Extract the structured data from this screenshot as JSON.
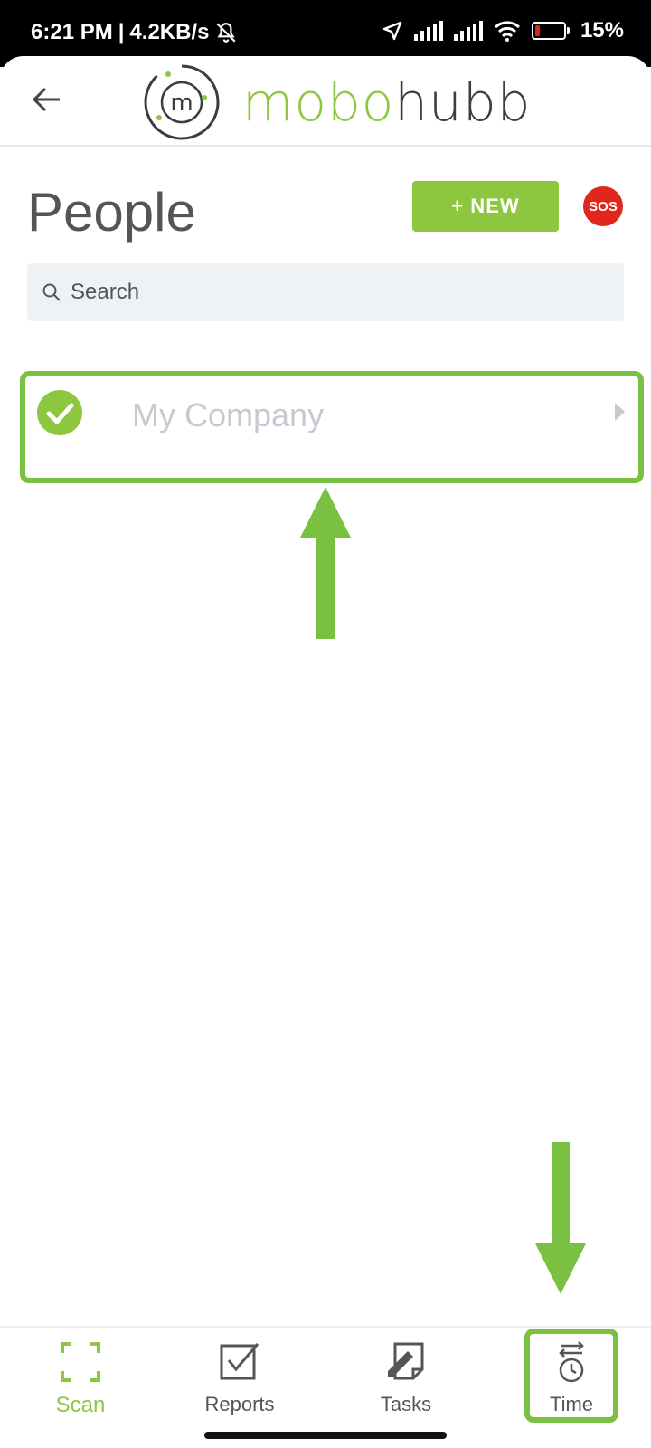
{
  "status_bar": {
    "time": "6:21 PM",
    "separator": "|",
    "network_speed": "4.2KB/s",
    "battery_percent": "15%",
    "battery_level": 0.15,
    "icons": [
      "mute-bell-icon",
      "location-icon",
      "signal-icon",
      "signal-icon",
      "wifi-icon",
      "battery-icon"
    ]
  },
  "header": {
    "logo_text_part1": "mobo",
    "logo_text_part2": "hubb",
    "logo_mark_letter": "m",
    "back_icon": "arrow-left-icon"
  },
  "page": {
    "title": "People",
    "new_button_label": "+ NEW",
    "sos_label": "SOS"
  },
  "search": {
    "placeholder": "Search",
    "value": ""
  },
  "list": {
    "items": [
      {
        "label": "My Company",
        "selected": true
      }
    ]
  },
  "bottom_nav": {
    "items": [
      {
        "label": "Scan",
        "icon": "scan-icon",
        "active": true
      },
      {
        "label": "Reports",
        "icon": "reports-icon",
        "active": false
      },
      {
        "label": "Tasks",
        "icon": "tasks-icon",
        "active": false
      },
      {
        "label": "Time",
        "icon": "time-icon",
        "active": false
      }
    ]
  },
  "colors": {
    "brand_green": "#8dc63f",
    "highlight_green": "#7ac142",
    "sos_red": "#e1261c",
    "search_bg": "#eff2f5"
  }
}
